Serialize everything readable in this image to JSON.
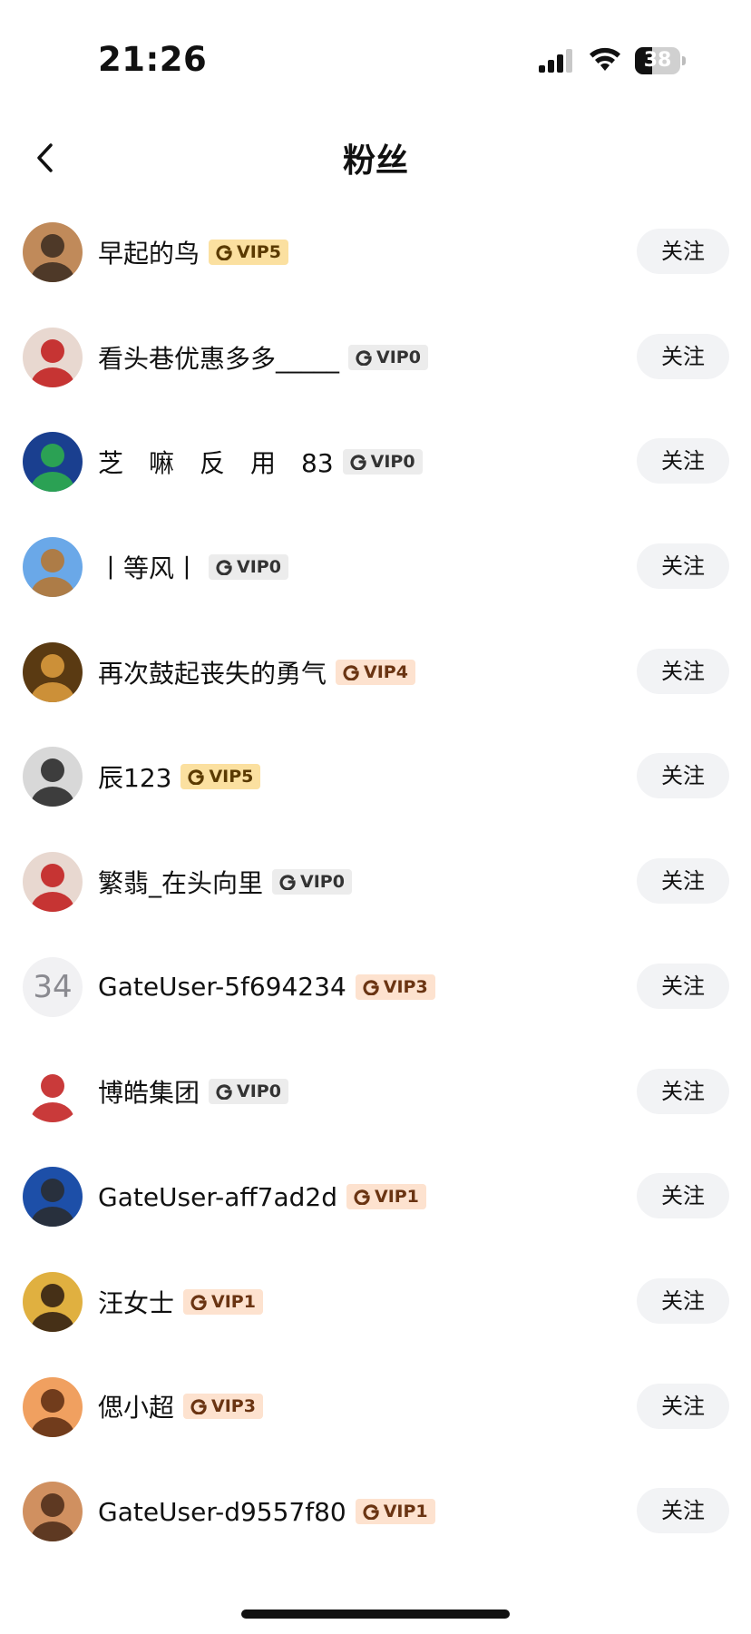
{
  "status_bar": {
    "time": "21:26",
    "battery": "38",
    "battery_level": 0.38
  },
  "nav": {
    "title": "粉丝"
  },
  "followers": [
    {
      "name": "早起的鸟",
      "vip": "VIP5",
      "badge_bg": "#fbe0a0",
      "badge_fg": "#5a3a00",
      "avatar": {
        "type": "photo",
        "bg": "#c08a5a",
        "fg": "#3a2a20"
      },
      "follow_label": "关注"
    },
    {
      "name": "看头巷优惠多多_____",
      "vip": "VIP0",
      "badge_bg": "#ececec",
      "badge_fg": "#333333",
      "avatar": {
        "type": "photo",
        "bg": "#e8d8d0",
        "fg": "#c01818"
      },
      "follow_label": "关注"
    },
    {
      "name": "芝　嘛　反　用　83",
      "vip": "VIP0",
      "badge_bg": "#ececec",
      "badge_fg": "#333333",
      "avatar": {
        "type": "photo",
        "bg": "#1a3f8f",
        "fg": "#2fb34a"
      },
      "follow_label": "关注"
    },
    {
      "name": "丨等风丨",
      "vip": "VIP0",
      "badge_bg": "#ececec",
      "badge_fg": "#333333",
      "avatar": {
        "type": "photo",
        "bg": "#6aa8e8",
        "fg": "#b8742a"
      },
      "follow_label": "关注"
    },
    {
      "name": "再次鼓起丧失的勇气",
      "vip": "VIP4",
      "badge_bg": "#fde2cf",
      "badge_fg": "#6a3412",
      "avatar": {
        "type": "photo",
        "bg": "#5a3a12",
        "fg": "#e0a040"
      },
      "follow_label": "关注"
    },
    {
      "name": "辰123",
      "vip": "VIP5",
      "badge_bg": "#fbe0a0",
      "badge_fg": "#5a3a00",
      "avatar": {
        "type": "photo",
        "bg": "#d8d8d8",
        "fg": "#222222"
      },
      "follow_label": "关注"
    },
    {
      "name": "繁翡_在头向里",
      "vip": "VIP0",
      "badge_bg": "#ececec",
      "badge_fg": "#333333",
      "avatar": {
        "type": "photo",
        "bg": "#e8d8d0",
        "fg": "#c01818"
      },
      "follow_label": "关注"
    },
    {
      "name": "GateUser-5f694234",
      "vip": "VIP3",
      "badge_bg": "#fde2cf",
      "badge_fg": "#6a3412",
      "avatar": {
        "type": "numeric",
        "text": "34"
      },
      "follow_label": "关注"
    },
    {
      "name": "博皓集团",
      "vip": "VIP0",
      "badge_bg": "#ececec",
      "badge_fg": "#333333",
      "avatar": {
        "type": "photo",
        "bg": "#ffffff",
        "fg": "#c01818"
      },
      "follow_label": "关注"
    },
    {
      "name": "GateUser-aff7ad2d",
      "vip": "VIP1",
      "badge_bg": "#fde2cf",
      "badge_fg": "#6a3412",
      "avatar": {
        "type": "photo",
        "bg": "#1d4fa8",
        "fg": "#2a2a2a"
      },
      "follow_label": "关注"
    },
    {
      "name": "汪女士",
      "vip": "VIP1",
      "badge_bg": "#fde2cf",
      "badge_fg": "#6a3412",
      "avatar": {
        "type": "photo",
        "bg": "#e0b040",
        "fg": "#2a1a10"
      },
      "follow_label": "关注"
    },
    {
      "name": "偲小超",
      "vip": "VIP3",
      "badge_bg": "#fde2cf",
      "badge_fg": "#6a3412",
      "avatar": {
        "type": "photo",
        "bg": "#f0a060",
        "fg": "#5a2a10"
      },
      "follow_label": "关注"
    },
    {
      "name": "GateUser-d9557f80",
      "vip": "VIP1",
      "badge_bg": "#fde2cf",
      "badge_fg": "#6a3412",
      "avatar": {
        "type": "photo",
        "bg": "#d09060",
        "fg": "#4a2a18"
      },
      "follow_label": "关注"
    }
  ]
}
